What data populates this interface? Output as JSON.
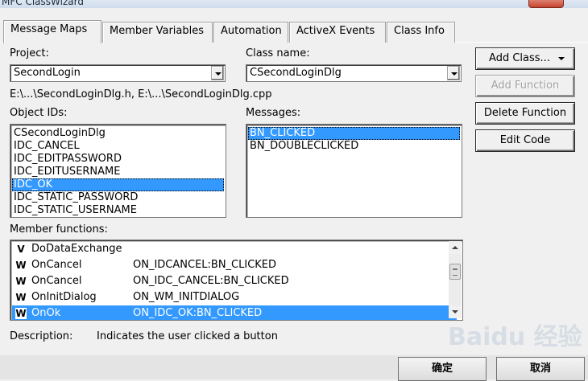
{
  "window": {
    "title": "MFC ClassWizard"
  },
  "tabs": [
    {
      "label": "Message Maps",
      "active": true
    },
    {
      "label": "Member Variables",
      "active": false
    },
    {
      "label": "Automation",
      "active": false
    },
    {
      "label": "ActiveX Events",
      "active": false
    },
    {
      "label": "Class Info",
      "active": false
    }
  ],
  "project": {
    "label": "Project:",
    "value": "SecondLogin"
  },
  "class_name": {
    "label": "Class name:",
    "value": "CSecondLoginDlg"
  },
  "file_path": "E:\\...\\SecondLoginDlg.h, E:\\...\\SecondLoginDlg.cpp",
  "object_ids": {
    "label": "Object IDs:",
    "items": [
      "CSecondLoginDlg",
      "IDC_CANCEL",
      "IDC_EDITPASSWORD",
      "IDC_EDITUSERNAME",
      "IDC_OK",
      "IDC_STATIC_PASSWORD",
      "IDC_STATIC_USERNAME"
    ],
    "selected": "IDC_OK"
  },
  "messages": {
    "label": "Messages:",
    "items": [
      "BN_CLICKED",
      "BN_DOUBLECLICKED"
    ],
    "selected": "BN_CLICKED"
  },
  "buttons": {
    "add_class": "Add Class...",
    "add_function": "Add Function",
    "delete_function": "Delete Function",
    "edit_code": "Edit Code"
  },
  "member_functions": {
    "label": "Member functions:",
    "rows": [
      {
        "icon": "V",
        "name": "DoDataExchange",
        "message": ""
      },
      {
        "icon": "W",
        "name": "OnCancel",
        "message": "ON_IDCANCEL:BN_CLICKED"
      },
      {
        "icon": "W",
        "name": "OnCancel",
        "message": "ON_IDC_CANCEL:BN_CLICKED"
      },
      {
        "icon": "W",
        "name": "OnInitDialog",
        "message": "ON_WM_INITDIALOG"
      },
      {
        "icon": "W",
        "name": "OnOk",
        "message": "ON_IDC_OK:BN_CLICKED"
      }
    ],
    "selected_index": 4
  },
  "description": {
    "label": "Description:",
    "text": "Indicates the user clicked a button"
  },
  "footer": {
    "ok": "确定",
    "cancel": "取消"
  },
  "watermark": "Baidu 经验",
  "colors": {
    "selection": "#3399ff",
    "dialog_bg": "#f0f0f0",
    "disabled_text": "#a0a0a0"
  }
}
